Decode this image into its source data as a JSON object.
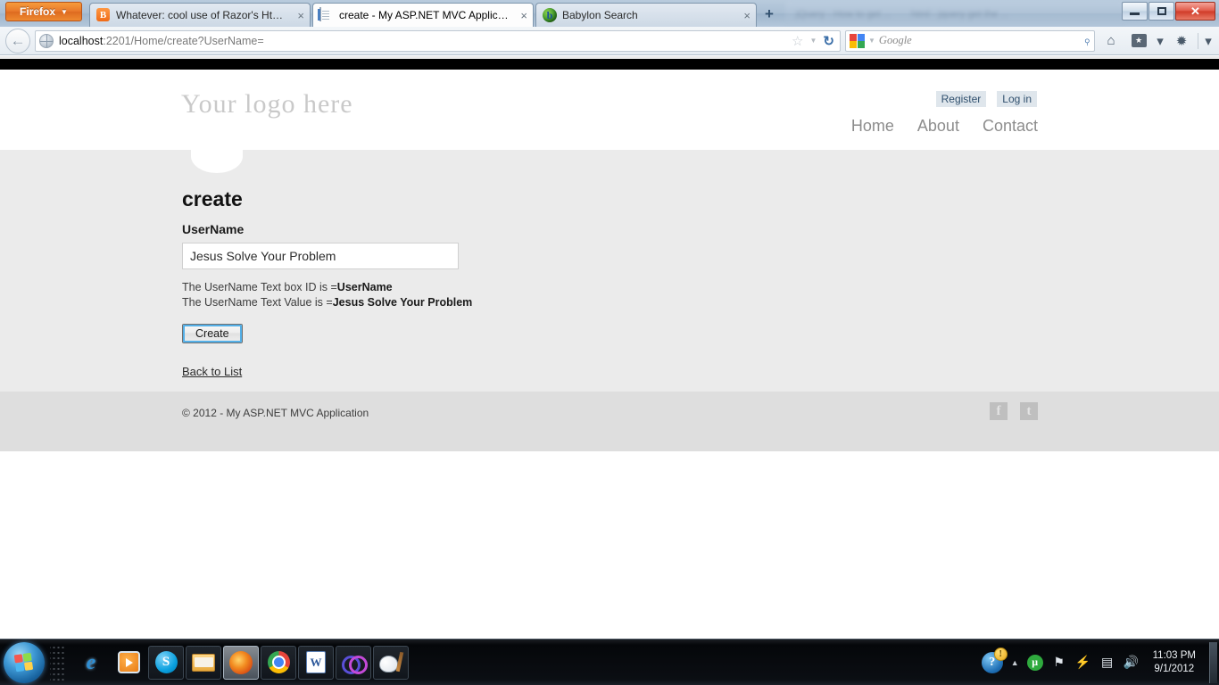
{
  "browser": {
    "app_button": {
      "label": "Firefox",
      "caret": "▼"
    },
    "tabs": [
      {
        "title": "Whatever: cool use of Razor's Html.Id...",
        "favicon": "blogger-icon",
        "active": false,
        "close": "×"
      },
      {
        "title": "create - My ASP.NET MVC Application",
        "favicon": "document-icon",
        "active": true,
        "close": "×"
      },
      {
        "title": "Babylon Search",
        "favicon": "babylon-icon",
        "active": false,
        "close": "×"
      }
    ],
    "ghost_tabs": [
      {
        "title": "jQuery - How to get ..."
      },
      {
        "title": "html - jquery get the ..."
      }
    ],
    "new_tab_label": "+",
    "window_controls": {
      "minimize": "minimize-icon",
      "maximize": "maximize-icon",
      "close": "✕"
    },
    "nav": {
      "back_label": "←",
      "url_host": "localhost",
      "url_path": ":2201/Home/create?UserName=",
      "bookmark_star": "☆",
      "bookmark_caret": "▼",
      "reload": "↻",
      "search_engine": "Google",
      "search_placeholder": "Google",
      "search_caret": "▼",
      "magnify": "⌕",
      "home_icon": "⌂",
      "bookmarks_icon": "★",
      "bookmarks_caret": "▾",
      "addon_caret": "▾"
    }
  },
  "site": {
    "logo": "Your logo here",
    "auth_links": [
      {
        "label": "Register"
      },
      {
        "label": "Log in"
      }
    ],
    "main_nav": [
      {
        "label": "Home"
      },
      {
        "label": "About"
      },
      {
        "label": "Contact"
      }
    ]
  },
  "main": {
    "title": "create",
    "field_label": "UserName",
    "input": {
      "value": "Jesus Solve Your Problem",
      "placeholder": ""
    },
    "echo": [
      {
        "prefix": "The UserName Text box ID is =",
        "value": "UserName"
      },
      {
        "prefix": "The UserName Text Value is =",
        "value": "Jesus Solve Your Problem"
      }
    ],
    "submit_label": "Create",
    "back_link": "Back to List"
  },
  "footer": {
    "copyright": "© 2012 - My ASP.NET MVC Application",
    "social": [
      {
        "name": "facebook-icon",
        "glyph": "f"
      },
      {
        "name": "twitter-icon",
        "glyph": "t"
      }
    ]
  },
  "taskbar": {
    "start": "windows-start-orb",
    "apps": [
      {
        "name": "internet-explorer",
        "glyph": "e",
        "state": "pinned"
      },
      {
        "name": "windows-media-player",
        "glyph": "▶",
        "state": "pinned"
      },
      {
        "name": "skype",
        "glyph": "S",
        "state": "running"
      },
      {
        "name": "windows-explorer",
        "glyph": "",
        "state": "running"
      },
      {
        "name": "firefox",
        "glyph": "",
        "state": "active"
      },
      {
        "name": "google-chrome",
        "glyph": "",
        "state": "running"
      },
      {
        "name": "microsoft-word",
        "glyph": "W",
        "state": "running"
      },
      {
        "name": "loop-app",
        "glyph": "",
        "state": "running"
      },
      {
        "name": "paint-app",
        "glyph": "",
        "state": "running"
      }
    ],
    "tray": {
      "action_center": {
        "glyph": "?",
        "badge": "!"
      },
      "overflow_caret": "▲",
      "utorrent": "μ",
      "flag": "⚑",
      "power": "⚡",
      "network": "▤",
      "volume": "🔊",
      "time": "11:03 PM",
      "date": "9/1/2012"
    }
  },
  "colors": {
    "page_bg": "#ebebeb",
    "footer_bg": "#dedede",
    "header_bg": "#ffffff",
    "logo_gray": "#c9c9c9",
    "nav_gray": "#8d8d8d",
    "auth_bg": "#dfe6ec",
    "focus_ring": "#54b0e8",
    "firefox_orange": "#e8772a"
  }
}
